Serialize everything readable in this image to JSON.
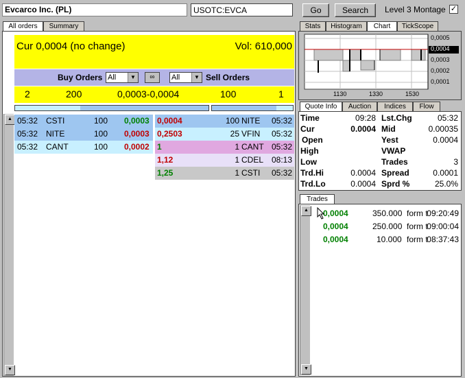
{
  "header": {
    "company": "Evcarco Inc. (PL)",
    "symbol": "USOTC:EVCA",
    "go_label": "Go",
    "search_label": "Search",
    "montage_label": "Level 3 Montage",
    "montage_checked": "✓"
  },
  "left_tabs": [
    "All orders",
    "Summary"
  ],
  "summary": {
    "cur": "Cur 0,0004 (no change)",
    "vol": "Vol: 610,000",
    "buy_label": "Buy Orders",
    "sell_label": "Sell Orders",
    "buy_filter": "All",
    "sell_filter": "All",
    "buy_count": "2",
    "buy_size": "200",
    "spread": "0,0003-0,0004",
    "sell_size": "100",
    "sell_count": "1"
  },
  "buy_orders": [
    {
      "time": "05:32",
      "mm": "CSTI",
      "size": "100",
      "price": "0,0003"
    },
    {
      "time": "05:32",
      "mm": "NITE",
      "size": "100",
      "price": "0,0003"
    },
    {
      "time": "05:32",
      "mm": "CANT",
      "size": "100",
      "price": "0,0002"
    }
  ],
  "sell_orders": [
    {
      "price": "0,0004",
      "size": "100",
      "mm": "NITE",
      "time": "05:32"
    },
    {
      "price": "0,2503",
      "size": "25",
      "mm": "VFIN",
      "time": "05:32"
    },
    {
      "price": "1",
      "size": "1",
      "mm": "CANT",
      "time": "05:32"
    },
    {
      "price": "1,12",
      "size": "1",
      "mm": "CDEL",
      "time": "08:13"
    },
    {
      "price": "1,25",
      "size": "1",
      "mm": "CSTI",
      "time": "05:32"
    }
  ],
  "right_top_tabs": [
    "Stats",
    "Histogram",
    "Chart",
    "TickScope"
  ],
  "chart": {
    "y_ticks": [
      "0,0005",
      "0,0004",
      "0,0003",
      "0,0002",
      "0,0001"
    ],
    "x_ticks": [
      "1130",
      "1330",
      "1530"
    ]
  },
  "quote_tabs": [
    "Quote Info",
    "Auction",
    "Indices",
    "Flow"
  ],
  "quote_info": [
    {
      "l1": "Time",
      "v1": "09:28",
      "l2": "Lst.Chg",
      "v2": "05:32"
    },
    {
      "l1": "Cur",
      "v1": "0.0004",
      "l2": "Mid",
      "v2": "0.00035"
    },
    {
      "l1": "Open",
      "v1": "",
      "l2": "Yest",
      "v2": "0.0004"
    },
    {
      "l1": "High",
      "v1": "",
      "l2": "VWAP",
      "v2": ""
    },
    {
      "l1": "Low",
      "v1": "",
      "l2": "Trades",
      "v2": "3"
    },
    {
      "l1": "Trd.Hi",
      "v1": "0.0004",
      "l2": "Spread",
      "v2": "0.0001"
    },
    {
      "l1": "Trd.Lo",
      "v1": "0.0004",
      "l2": "Sprd %",
      "v2": "25.0%"
    }
  ],
  "trades_tab": "Trades",
  "trades": [
    {
      "price": "0,0004",
      "size": "350.000",
      "cond": "form t",
      "time": "09:20:49"
    },
    {
      "price": "0,0004",
      "size": "250.000",
      "cond": "form t",
      "time": "09:00:04"
    },
    {
      "price": "0,0004",
      "size": "10.000",
      "cond": "form t",
      "time": "08:37:43"
    }
  ]
}
